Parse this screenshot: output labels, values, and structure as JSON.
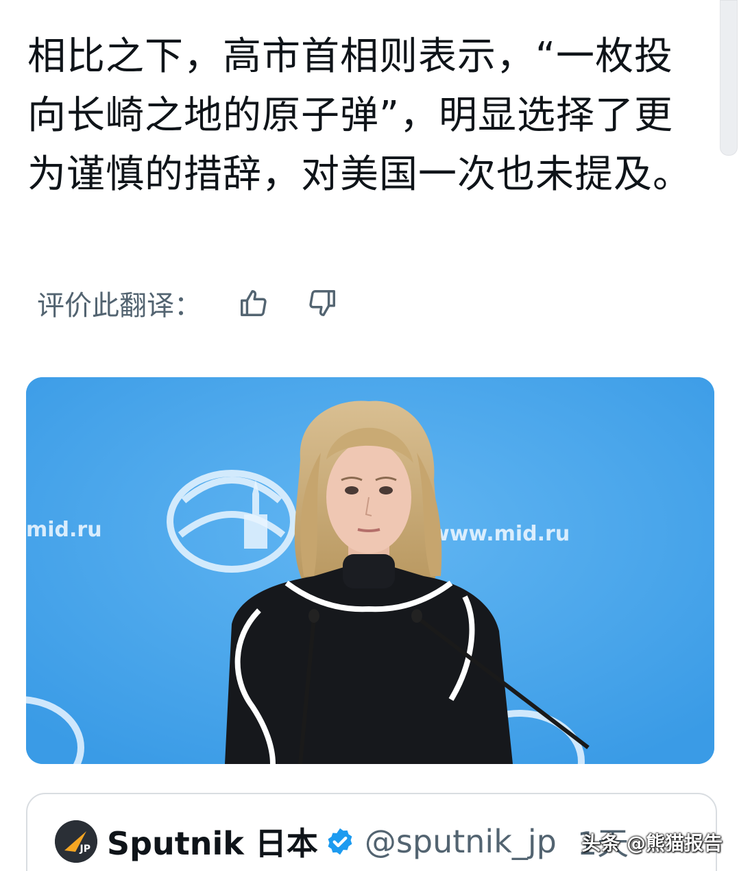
{
  "tweet": {
    "translated_text": "相比之下，高市首相则表示，“一枚投向长崎之地的原子弹”，明显选择了更为谨慎的措辞，对美国一次也未提及。"
  },
  "rating": {
    "label": "评价此翻译：",
    "like_icon": "thumbs-up-icon",
    "dislike_icon": "thumbs-down-icon"
  },
  "media": {
    "backdrop_texts": [
      "mid.ru",
      "www.mid.ru"
    ],
    "backdrop_color": "#3b9de8"
  },
  "quote": {
    "display_name": "Sputnik 日本",
    "avatar_label": "JP",
    "handle": "@sputnik_jp",
    "time": "1天",
    "verified_color": "#1d9bf0",
    "avatar_accent": "#f5a623"
  },
  "watermark": {
    "text": "头条 @熊猫报告"
  }
}
